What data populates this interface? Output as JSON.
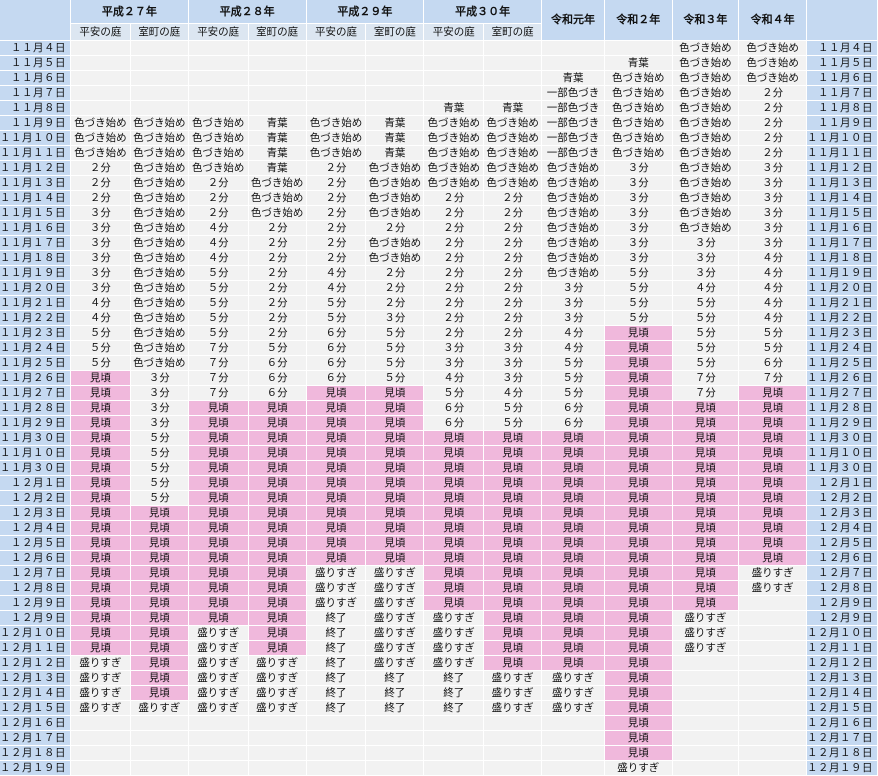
{
  "years": [
    {
      "label": "平成２７年",
      "span": 2
    },
    {
      "label": "平成２８年",
      "span": 2
    },
    {
      "label": "平成２９年",
      "span": 2
    },
    {
      "label": "平成３０年",
      "span": 2
    },
    {
      "label": "令和元年",
      "span": 1
    },
    {
      "label": "令和２年",
      "span": 1
    },
    {
      "label": "令和３年",
      "span": 1
    },
    {
      "label": "令和４年",
      "span": 1
    }
  ],
  "subheaders": [
    "平安の庭",
    "室町の庭",
    "平安の庭",
    "室町の庭",
    "平安の庭",
    "室町の庭",
    "平安の庭",
    "室町の庭",
    "",
    "",
    "",
    ""
  ],
  "highlight_color": "#f0b8dc",
  "highlight_value": "見頃",
  "rows": [
    {
      "date": "１１月４日",
      "cells": [
        "",
        "",
        "",
        "",
        "",
        "",
        "",
        "",
        "",
        "",
        "色づき始め",
        "色づき始め"
      ]
    },
    {
      "date": "１１月５日",
      "cells": [
        "",
        "",
        "",
        "",
        "",
        "",
        "",
        "",
        "",
        "青葉",
        "色づき始め",
        "色づき始め"
      ]
    },
    {
      "date": "１１月６日",
      "cells": [
        "",
        "",
        "",
        "",
        "",
        "",
        "",
        "",
        "青葉",
        "色づき始め",
        "色づき始め",
        "色づき始め"
      ]
    },
    {
      "date": "１１月７日",
      "cells": [
        "",
        "",
        "",
        "",
        "",
        "",
        "",
        "",
        "一部色づき",
        "色づき始め",
        "色づき始め",
        "２分"
      ]
    },
    {
      "date": "１１月８日",
      "cells": [
        "",
        "",
        "",
        "",
        "",
        "",
        "青葉",
        "青葉",
        "一部色づき",
        "色づき始め",
        "色づき始め",
        "２分"
      ]
    },
    {
      "date": "１１月９日",
      "cells": [
        "色づき始め",
        "色づき始め",
        "色づき始め",
        "青葉",
        "色づき始め",
        "青葉",
        "色づき始め",
        "色づき始め",
        "一部色づき",
        "色づき始め",
        "色づき始め",
        "２分"
      ]
    },
    {
      "date": "１１月１０日",
      "cells": [
        "色づき始め",
        "色づき始め",
        "色づき始め",
        "青葉",
        "色づき始め",
        "青葉",
        "色づき始め",
        "色づき始め",
        "一部色づき",
        "色づき始め",
        "色づき始め",
        "２分"
      ]
    },
    {
      "date": "１１月１１日",
      "cells": [
        "色づき始め",
        "色づき始め",
        "色づき始め",
        "青葉",
        "色づき始め",
        "青葉",
        "色づき始め",
        "色づき始め",
        "一部色づき",
        "色づき始め",
        "色づき始め",
        "２分"
      ]
    },
    {
      "date": "１１月１２日",
      "cells": [
        "２分",
        "色づき始め",
        "色づき始め",
        "青葉",
        "２分",
        "色づき始め",
        "色づき始め",
        "色づき始め",
        "色づき始め",
        "３分",
        "色づき始め",
        "３分"
      ]
    },
    {
      "date": "１１月１３日",
      "cells": [
        "２分",
        "色づき始め",
        "２分",
        "色づき始め",
        "２分",
        "色づき始め",
        "色づき始め",
        "色づき始め",
        "色づき始め",
        "３分",
        "色づき始め",
        "３分"
      ]
    },
    {
      "date": "１１月１４日",
      "cells": [
        "２分",
        "色づき始め",
        "２分",
        "色づき始め",
        "２分",
        "色づき始め",
        "２分",
        "２分",
        "色づき始め",
        "３分",
        "色づき始め",
        "３分"
      ]
    },
    {
      "date": "１１月１５日",
      "cells": [
        "３分",
        "色づき始め",
        "２分",
        "色づき始め",
        "２分",
        "色づき始め",
        "２分",
        "２分",
        "色づき始め",
        "３分",
        "色づき始め",
        "３分"
      ]
    },
    {
      "date": "１１月１６日",
      "cells": [
        "３分",
        "色づき始め",
        "４分",
        "２分",
        "２分",
        "２分",
        "２分",
        "２分",
        "色づき始め",
        "３分",
        "色づき始め",
        "３分"
      ]
    },
    {
      "date": "１１月１７日",
      "cells": [
        "３分",
        "色づき始め",
        "４分",
        "２分",
        "２分",
        "色づき始め",
        "２分",
        "２分",
        "色づき始め",
        "３分",
        "３分",
        "３分"
      ]
    },
    {
      "date": "１１月１８日",
      "cells": [
        "３分",
        "色づき始め",
        "４分",
        "２分",
        "２分",
        "色づき始め",
        "２分",
        "２分",
        "色づき始め",
        "３分",
        "３分",
        "４分"
      ]
    },
    {
      "date": "１１月１９日",
      "cells": [
        "３分",
        "色づき始め",
        "５分",
        "２分",
        "４分",
        "２分",
        "２分",
        "２分",
        "色づき始め",
        "５分",
        "３分",
        "４分"
      ]
    },
    {
      "date": "１１月２０日",
      "cells": [
        "３分",
        "色づき始め",
        "５分",
        "２分",
        "４分",
        "２分",
        "２分",
        "２分",
        "３分",
        "５分",
        "４分",
        "４分"
      ]
    },
    {
      "date": "１１月２１日",
      "cells": [
        "４分",
        "色づき始め",
        "５分",
        "２分",
        "５分",
        "２分",
        "２分",
        "２分",
        "３分",
        "５分",
        "５分",
        "４分"
      ]
    },
    {
      "date": "１１月２２日",
      "cells": [
        "４分",
        "色づき始め",
        "５分",
        "２分",
        "５分",
        "３分",
        "２分",
        "２分",
        "３分",
        "５分",
        "５分",
        "４分"
      ]
    },
    {
      "date": "１１月２３日",
      "cells": [
        "５分",
        "色づき始め",
        "５分",
        "２分",
        "６分",
        "５分",
        "２分",
        "２分",
        "４分",
        "見頃",
        "５分",
        "５分"
      ]
    },
    {
      "date": "１１月２４日",
      "cells": [
        "５分",
        "色づき始め",
        "７分",
        "５分",
        "６分",
        "５分",
        "３分",
        "３分",
        "４分",
        "見頃",
        "５分",
        "５分"
      ]
    },
    {
      "date": "１１月２５日",
      "cells": [
        "５分",
        "色づき始め",
        "７分",
        "６分",
        "６分",
        "５分",
        "３分",
        "３分",
        "５分",
        "見頃",
        "５分",
        "６分"
      ]
    },
    {
      "date": "１１月２６日",
      "cells": [
        "見頃",
        "３分",
        "７分",
        "６分",
        "６分",
        "５分",
        "４分",
        "３分",
        "５分",
        "見頃",
        "７分",
        "７分"
      ]
    },
    {
      "date": "１１月２７日",
      "cells": [
        "見頃",
        "３分",
        "７分",
        "６分",
        "見頃",
        "見頃",
        "５分",
        "４分",
        "５分",
        "見頃",
        "７分",
        "見頃"
      ]
    },
    {
      "date": "１１月２８日",
      "cells": [
        "見頃",
        "３分",
        "見頃",
        "見頃",
        "見頃",
        "見頃",
        "６分",
        "５分",
        "６分",
        "見頃",
        "見頃",
        "見頃"
      ]
    },
    {
      "date": "１１月２９日",
      "cells": [
        "見頃",
        "３分",
        "見頃",
        "見頃",
        "見頃",
        "見頃",
        "６分",
        "５分",
        "６分",
        "見頃",
        "見頃",
        "見頃"
      ]
    },
    {
      "date": "１１月３０日",
      "cells": [
        "見頃",
        "５分",
        "見頃",
        "見頃",
        "見頃",
        "見頃",
        "見頃",
        "見頃",
        "見頃",
        "見頃",
        "見頃",
        "見頃"
      ]
    },
    {
      "date": "１１月１０日",
      "cells": [
        "見頃",
        "５分",
        "見頃",
        "見頃",
        "見頃",
        "見頃",
        "見頃",
        "見頃",
        "見頃",
        "見頃",
        "見頃",
        "見頃"
      ]
    },
    {
      "date": "１１月３０日",
      "cells": [
        "見頃",
        "５分",
        "見頃",
        "見頃",
        "見頃",
        "見頃",
        "見頃",
        "見頃",
        "見頃",
        "見頃",
        "見頃",
        "見頃"
      ]
    },
    {
      "date": "１２月１日",
      "cells": [
        "見頃",
        "５分",
        "見頃",
        "見頃",
        "見頃",
        "見頃",
        "見頃",
        "見頃",
        "見頃",
        "見頃",
        "見頃",
        "見頃"
      ]
    },
    {
      "date": "１２月２日",
      "cells": [
        "見頃",
        "５分",
        "見頃",
        "見頃",
        "見頃",
        "見頃",
        "見頃",
        "見頃",
        "見頃",
        "見頃",
        "見頃",
        "見頃"
      ]
    },
    {
      "date": "１２月３日",
      "cells": [
        "見頃",
        "見頃",
        "見頃",
        "見頃",
        "見頃",
        "見頃",
        "見頃",
        "見頃",
        "見頃",
        "見頃",
        "見頃",
        "見頃"
      ]
    },
    {
      "date": "１２月４日",
      "cells": [
        "見頃",
        "見頃",
        "見頃",
        "見頃",
        "見頃",
        "見頃",
        "見頃",
        "見頃",
        "見頃",
        "見頃",
        "見頃",
        "見頃"
      ]
    },
    {
      "date": "１２月５日",
      "cells": [
        "見頃",
        "見頃",
        "見頃",
        "見頃",
        "見頃",
        "見頃",
        "見頃",
        "見頃",
        "見頃",
        "見頃",
        "見頃",
        "見頃"
      ]
    },
    {
      "date": "１２月６日",
      "cells": [
        "見頃",
        "見頃",
        "見頃",
        "見頃",
        "見頃",
        "見頃",
        "見頃",
        "見頃",
        "見頃",
        "見頃",
        "見頃",
        "見頃"
      ]
    },
    {
      "date": "１２月７日",
      "cells": [
        "見頃",
        "見頃",
        "見頃",
        "見頃",
        "盛りすぎ",
        "盛りすぎ",
        "見頃",
        "見頃",
        "見頃",
        "見頃",
        "見頃",
        "盛りすぎ"
      ]
    },
    {
      "date": "１２月８日",
      "cells": [
        "見頃",
        "見頃",
        "見頃",
        "見頃",
        "盛りすぎ",
        "盛りすぎ",
        "見頃",
        "見頃",
        "見頃",
        "見頃",
        "見頃",
        "盛りすぎ"
      ]
    },
    {
      "date": "１２月９日",
      "cells": [
        "見頃",
        "見頃",
        "見頃",
        "見頃",
        "盛りすぎ",
        "盛りすぎ",
        "見頃",
        "見頃",
        "見頃",
        "見頃",
        "見頃",
        ""
      ]
    },
    {
      "date": "１２月９日",
      "cells": [
        "見頃",
        "見頃",
        "見頃",
        "見頃",
        "終了",
        "盛りすぎ",
        "盛りすぎ",
        "見頃",
        "見頃",
        "見頃",
        "盛りすぎ",
        ""
      ]
    },
    {
      "date": "１２月１０日",
      "cells": [
        "見頃",
        "見頃",
        "盛りすぎ",
        "見頃",
        "終了",
        "盛りすぎ",
        "盛りすぎ",
        "見頃",
        "見頃",
        "見頃",
        "盛りすぎ",
        ""
      ]
    },
    {
      "date": "１２月１１日",
      "cells": [
        "見頃",
        "見頃",
        "盛りすぎ",
        "見頃",
        "終了",
        "盛りすぎ",
        "盛りすぎ",
        "見頃",
        "見頃",
        "見頃",
        "盛りすぎ",
        ""
      ]
    },
    {
      "date": "１２月１２日",
      "cells": [
        "盛りすぎ",
        "見頃",
        "盛りすぎ",
        "盛りすぎ",
        "終了",
        "盛りすぎ",
        "盛りすぎ",
        "見頃",
        "見頃",
        "見頃",
        "",
        ""
      ]
    },
    {
      "date": "１２月１３日",
      "cells": [
        "盛りすぎ",
        "見頃",
        "盛りすぎ",
        "盛りすぎ",
        "終了",
        "終了",
        "終了",
        "盛りすぎ",
        "盛りすぎ",
        "見頃",
        "",
        ""
      ]
    },
    {
      "date": "１２月１４日",
      "cells": [
        "盛りすぎ",
        "見頃",
        "盛りすぎ",
        "盛りすぎ",
        "終了",
        "終了",
        "終了",
        "盛りすぎ",
        "盛りすぎ",
        "見頃",
        "",
        ""
      ]
    },
    {
      "date": "１２月１５日",
      "cells": [
        "盛りすぎ",
        "盛りすぎ",
        "盛りすぎ",
        "盛りすぎ",
        "終了",
        "終了",
        "終了",
        "盛りすぎ",
        "盛りすぎ",
        "見頃",
        "",
        ""
      ]
    },
    {
      "date": "１２月１６日",
      "cells": [
        "",
        "",
        "",
        "",
        "",
        "",
        "",
        "",
        "",
        "見頃",
        "",
        ""
      ]
    },
    {
      "date": "１２月１７日",
      "cells": [
        "",
        "",
        "",
        "",
        "",
        "",
        "",
        "",
        "",
        "見頃",
        "",
        ""
      ]
    },
    {
      "date": "１２月１８日",
      "cells": [
        "",
        "",
        "",
        "",
        "",
        "",
        "",
        "",
        "",
        "見頃",
        "",
        ""
      ]
    },
    {
      "date": "１２月１９日",
      "cells": [
        "",
        "",
        "",
        "",
        "",
        "",
        "",
        "",
        "",
        "盛りすぎ",
        "",
        ""
      ]
    }
  ]
}
